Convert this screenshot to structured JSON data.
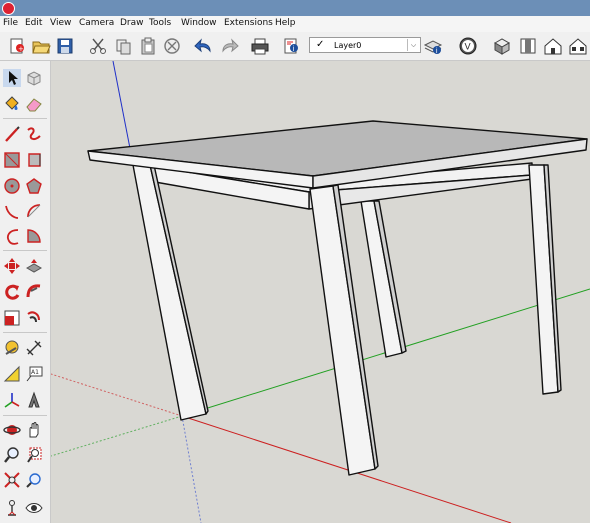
{
  "app": {
    "icon": "sketchup-icon"
  },
  "menu": {
    "items": [
      "File",
      "Edit",
      "View",
      "Camera",
      "Draw",
      "Tools",
      "Window",
      "Extensions",
      "Help"
    ]
  },
  "toolbar": {
    "layer_current": "Layer0",
    "layer_check": "✓",
    "layer_arrow": "⌵",
    "tools": [
      "new-model-icon",
      "open-icon",
      "save-icon",
      "cut-icon",
      "copy-icon",
      "paste-icon",
      "erase-icon",
      "undo-icon",
      "redo-icon",
      "print-icon",
      "model-info-icon",
      "layer-visible-check",
      "layer-manager-icon",
      "extension-warehouse-icon",
      "iso-view-icon",
      "top-view-icon",
      "front-view-icon",
      "right-view-icon"
    ]
  },
  "sidebar": {
    "tools": [
      "select-icon",
      "make-component-icon",
      "paint-bucket-icon",
      "eraser-icon",
      "line-icon",
      "freehand-icon",
      "rectangle-icon",
      "rotated-rectangle-icon",
      "circle-icon",
      "polygon-icon",
      "arc-icon",
      "two-point-arc-icon",
      "three-point-arc-icon",
      "pie-icon",
      "move-icon",
      "push-pull-icon",
      "rotate-icon",
      "follow-me-icon",
      "scale-icon",
      "offset-icon",
      "tape-measure-icon",
      "dimension-icon",
      "protractor-icon",
      "text-icon",
      "axes-icon",
      "3d-text-icon",
      "orbit-icon",
      "pan-icon",
      "zoom-icon",
      "zoom-window-icon",
      "zoom-extents-icon",
      "previous-view-icon",
      "position-camera-icon",
      "look-around-icon"
    ]
  },
  "colors": {
    "titlebar": "#6c8fb7",
    "viewport_bg": "#d9d8d3",
    "axis_red": "#cc2020",
    "axis_green": "#22a022",
    "axis_blue": "#2030c8",
    "table_top": "#b8b8b8",
    "table_side": "#f4f4f4"
  }
}
